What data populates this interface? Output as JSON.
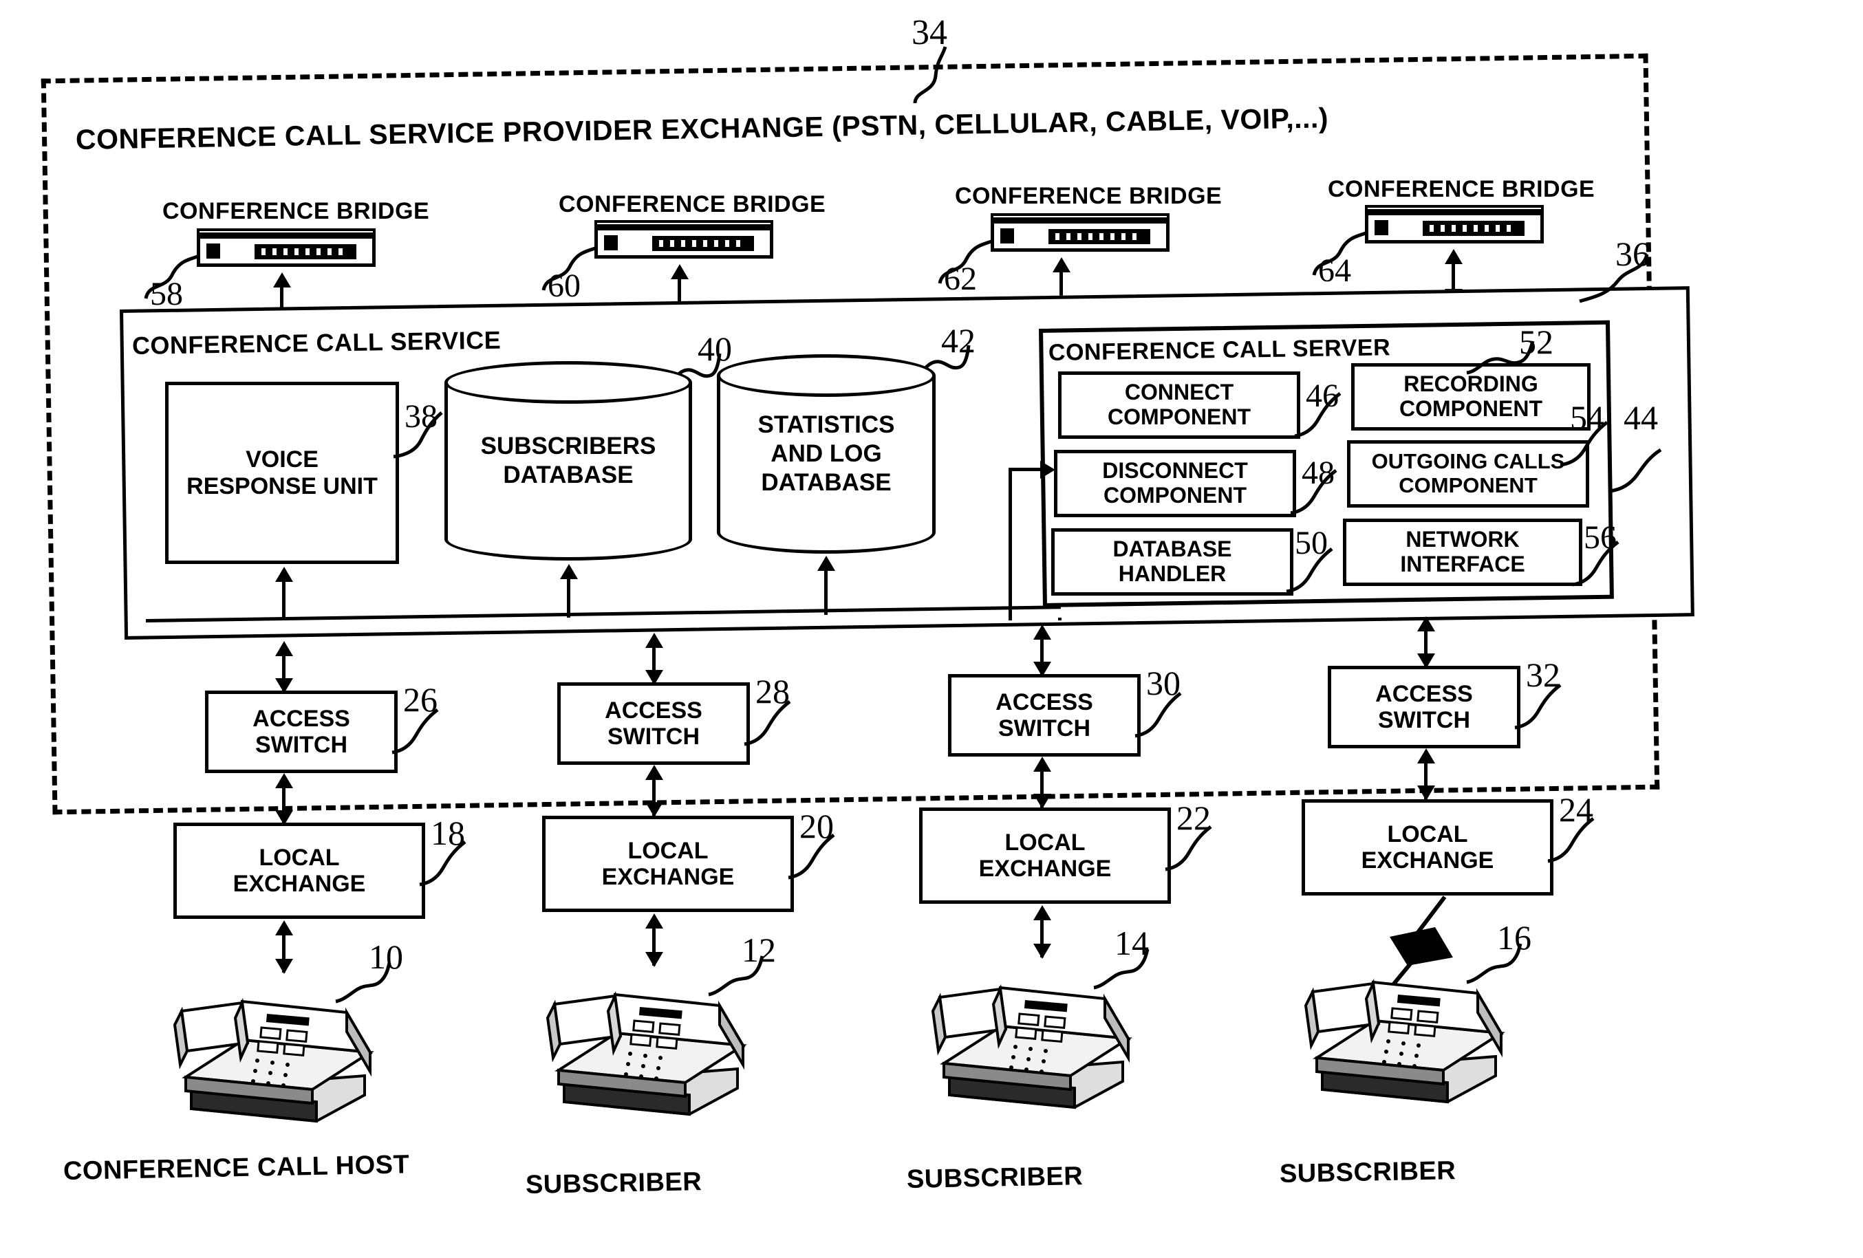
{
  "figure": {
    "outer_boundary_label": "CONFERENCE CALL SERVICE PROVIDER EXCHANGE  (PSTN, CELLULAR, CABLE, VOIP,...)",
    "outer_boundary_ref": "34"
  },
  "conference_bridges": [
    {
      "label": "CONFERENCE BRIDGE",
      "ref": "58"
    },
    {
      "label": "CONFERENCE BRIDGE",
      "ref": "60"
    },
    {
      "label": "CONFERENCE BRIDGE",
      "ref": "62"
    },
    {
      "label": "CONFERENCE BRIDGE",
      "ref": "64"
    }
  ],
  "conference_call_service": {
    "label": "CONFERENCE CALL SERVICE",
    "ref": "36",
    "voice_response_unit": {
      "label": "VOICE\nRESPONSE UNIT",
      "line1": "VOICE",
      "line2": "RESPONSE UNIT",
      "ref": "38"
    },
    "databases": [
      {
        "line1": "SUBSCRIBERS",
        "line2": "DATABASE",
        "ref": "40"
      },
      {
        "line1": "STATISTICS",
        "line2": "AND LOG",
        "line3": "DATABASE",
        "ref": "42"
      }
    ]
  },
  "conference_call_server": {
    "label": "CONFERENCE CALL SERVER",
    "ref": "44",
    "components": [
      {
        "line1": "CONNECT",
        "line2": "COMPONENT",
        "ref": "46"
      },
      {
        "line1": "RECORDING",
        "line2": "COMPONENT",
        "ref": "52"
      },
      {
        "line1": "DISCONNECT",
        "line2": "COMPONENT",
        "ref": "48"
      },
      {
        "line1": "OUTGOING CALLS",
        "line2": "COMPONENT",
        "ref": "54"
      },
      {
        "line1": "DATABASE",
        "line2": "HANDLER",
        "ref": "50"
      },
      {
        "line1": "NETWORK",
        "line2": "INTERFACE",
        "ref": "56"
      }
    ]
  },
  "access_switches": [
    {
      "line1": "ACCESS",
      "line2": "SWITCH",
      "ref": "26"
    },
    {
      "line1": "ACCESS",
      "line2": "SWITCH",
      "ref": "28"
    },
    {
      "line1": "ACCESS",
      "line2": "SWITCH",
      "ref": "30"
    },
    {
      "line1": "ACCESS",
      "line2": "SWITCH",
      "ref": "32"
    }
  ],
  "local_exchanges": [
    {
      "line1": "LOCAL",
      "line2": "EXCHANGE",
      "ref": "18"
    },
    {
      "line1": "LOCAL",
      "line2": "EXCHANGE",
      "ref": "20"
    },
    {
      "line1": "LOCAL",
      "line2": "EXCHANGE",
      "ref": "22"
    },
    {
      "line1": "LOCAL",
      "line2": "EXCHANGE",
      "ref": "24"
    }
  ],
  "endpoints": [
    {
      "label": "CONFERENCE CALL HOST",
      "ref": "10",
      "link": "wired"
    },
    {
      "label": "SUBSCRIBER",
      "ref": "12",
      "link": "wired"
    },
    {
      "label": "SUBSCRIBER",
      "ref": "14",
      "link": "wired"
    },
    {
      "label": "SUBSCRIBER",
      "ref": "16",
      "link": "wireless"
    }
  ]
}
